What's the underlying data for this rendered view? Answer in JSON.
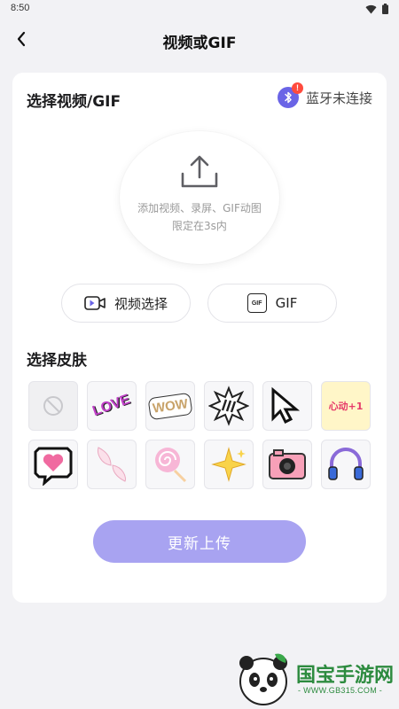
{
  "status_bar": {
    "time": "8:50"
  },
  "header": {
    "title": "视频或GIF"
  },
  "select_video": {
    "title": "选择视频/GIF",
    "bluetooth_status": "蓝牙未连接",
    "bluetooth_alert": "!",
    "upload_hint_line1": "添加视频、录屏、GIF动图",
    "upload_hint_line2": "限定在3s内",
    "video_select_label": "视频选择",
    "gif_label": "GIF",
    "gif_badge": "GIF"
  },
  "skins": {
    "title": "选择皮肤",
    "items": [
      {
        "name": "none",
        "text": ""
      },
      {
        "name": "love",
        "text": "LOVE"
      },
      {
        "name": "wow",
        "text": "WOW"
      },
      {
        "name": "comic-burst",
        "text": ""
      },
      {
        "name": "cursor",
        "text": ""
      },
      {
        "name": "heartbeat-crown",
        "text": "心动+1"
      },
      {
        "name": "heart-bubble",
        "text": ""
      },
      {
        "name": "wings",
        "text": ""
      },
      {
        "name": "lollipop",
        "text": ""
      },
      {
        "name": "sparkle",
        "text": ""
      },
      {
        "name": "camera",
        "text": ""
      },
      {
        "name": "headphones",
        "text": ""
      }
    ]
  },
  "actions": {
    "update_label": "更新上传"
  },
  "watermark": {
    "text": "国宝手游网",
    "url": "- WWW.GB315.COM -"
  },
  "colors": {
    "accent": "#6a64e6",
    "button": "#a8a3f1",
    "alert": "#ff4a3d"
  }
}
